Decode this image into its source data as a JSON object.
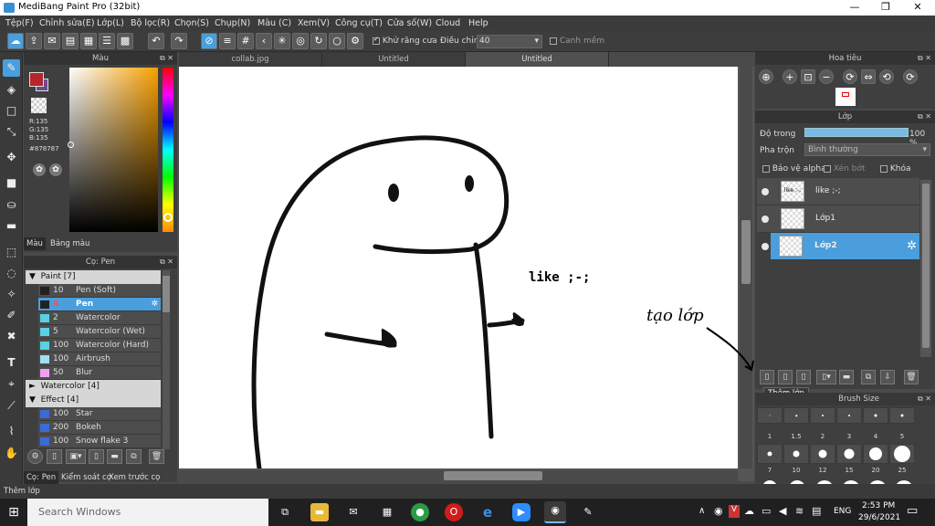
{
  "window": {
    "title": "MediBang Paint Pro (32bit)",
    "minimize": "—",
    "maximize": "❐",
    "close": "✕"
  },
  "menu": [
    "Tệp(F)",
    "Chỉnh sửa(E)",
    "Lớp(L)",
    "Bộ lọc(R)",
    "Chọn(S)",
    "Chụp(N)",
    "Màu (C)",
    "Xem(V)",
    "Công cụ(T)",
    "Cửa số(W)",
    "Cloud",
    "Help"
  ],
  "toolbar": {
    "antialias_label": "Khử răng cưa",
    "correction_label": "Điều chỉnh",
    "correction_value": "40",
    "snap_label": "Canh mềm"
  },
  "color_panel": {
    "title": "Màu",
    "r": "R:135",
    "g": "G:135",
    "b": "B:135",
    "hex": "#878787",
    "tab_color": "Màu",
    "tab_palette": "Bảng màu",
    "main_color": "#b5252b",
    "sub_color": "#6e4b8c"
  },
  "brush_panel": {
    "title": "Cọ: Pen",
    "groups": [
      {
        "label": "Paint [7]",
        "items": [
          {
            "size": "10",
            "name": "Pen (Soft)",
            "color": "#222222"
          },
          {
            "size": "4",
            "name": "Pen",
            "color": "#222222"
          },
          {
            "size": "2",
            "name": "Watercolor",
            "color": "#5ad1e0"
          },
          {
            "size": "5",
            "name": "Watercolor (Wet)",
            "color": "#5ad1e0"
          },
          {
            "size": "100",
            "name": "Watercolor (Hard)",
            "color": "#5ad1e0"
          },
          {
            "size": "100",
            "name": "Airbrush",
            "color": "#a0e0f0"
          },
          {
            "size": "50",
            "name": "Blur",
            "color": "#f0a0f0"
          }
        ]
      },
      {
        "label": "Watercolor [4]",
        "items": []
      },
      {
        "label": "Effect [4]",
        "items": [
          {
            "size": "100",
            "name": "Star",
            "color": "#3a6bd6"
          },
          {
            "size": "200",
            "name": "Bokeh",
            "color": "#3a6bd6"
          },
          {
            "size": "100",
            "name": "Snow flake 3",
            "color": "#3a6bd6"
          }
        ]
      }
    ],
    "tab_brush": "Cọ: Pen",
    "tab_control": "Kiểm soát cọ",
    "tab_preview": "Xem trước cọ"
  },
  "canvas_tabs": [
    "collab.jpg",
    "Untitled",
    "Untitled"
  ],
  "canvas": {
    "text_like": "like ;-;",
    "annotation": "tạo lớp"
  },
  "navigator": {
    "title": "Hoa tiêu"
  },
  "layer_panel": {
    "title": "Lớp",
    "opacity_label": "Độ trong",
    "opacity_value": "100 %",
    "blend_label": "Pha trộn",
    "blend_value": "Bình thường",
    "protect_alpha": "Bảo vệ alpha",
    "clipping": "Xén bớt",
    "lock": "Khóa",
    "layers": [
      "like ;-;",
      "Lớp1",
      "Lớp2"
    ],
    "tooltip": "Thêm lớp"
  },
  "brush_size": {
    "title": "Brush Size",
    "row1": [
      "1",
      "1.5",
      "2",
      "3",
      "4",
      "5"
    ],
    "row2": [
      "7",
      "10",
      "12",
      "15",
      "20",
      "25"
    ]
  },
  "status": {
    "text": "Thêm lớp"
  },
  "taskbar": {
    "search": "Search Windows",
    "lang": "ENG",
    "time": "2:53 PM",
    "date": "29/6/2021"
  }
}
